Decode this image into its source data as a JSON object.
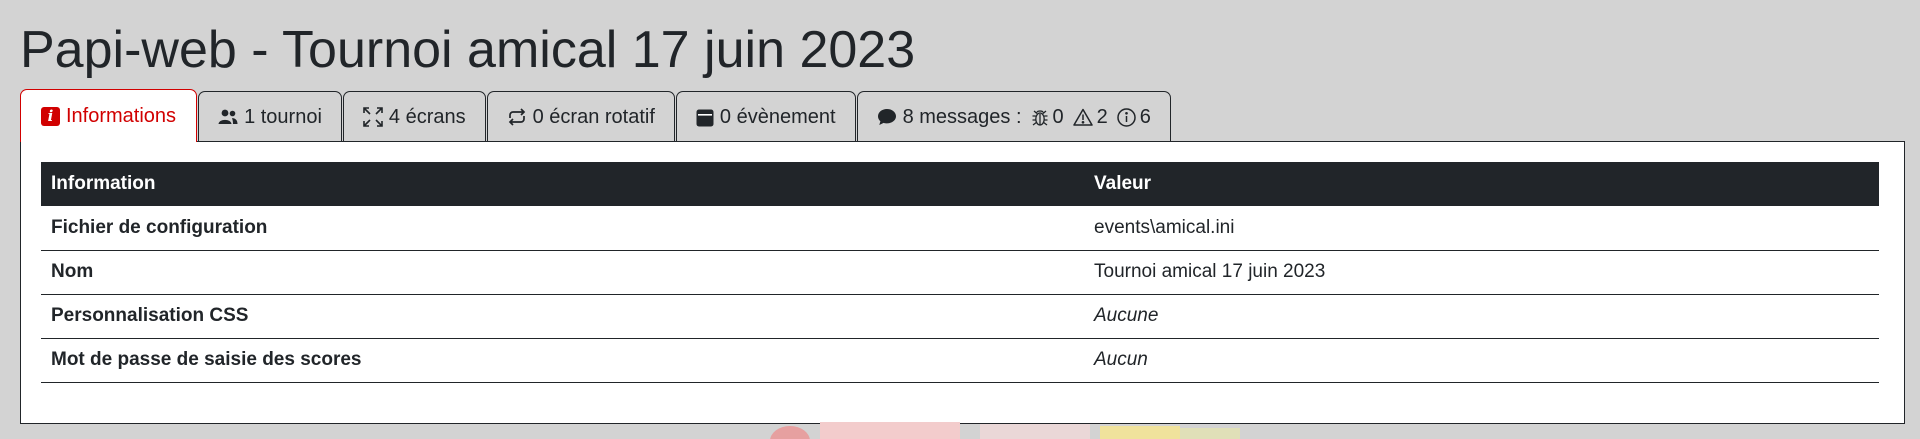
{
  "page": {
    "title": "Papi-web - Tournoi amical 17 juin 2023"
  },
  "tabs": [
    {
      "label": "Informations",
      "icon": "info-icon",
      "active": true
    },
    {
      "label": "1 tournoi",
      "icon": "users-icon",
      "active": false
    },
    {
      "label": "4 écrans",
      "icon": "fullscreen-icon",
      "active": false
    },
    {
      "label": "0 écran rotatif",
      "icon": "repeat-icon",
      "active": false
    },
    {
      "label": "0 évènement",
      "icon": "calendar-icon",
      "active": false
    },
    {
      "label": "8 messages :",
      "icon": "chat-icon",
      "active": false,
      "counts": {
        "bug": "0",
        "warning": "2",
        "info": "6"
      }
    }
  ],
  "table": {
    "headers": [
      "Information",
      "Valeur"
    ],
    "rows": [
      {
        "key": "Fichier de configuration",
        "value": "events\\amical.ini",
        "italic": false
      },
      {
        "key": "Nom",
        "value": "Tournoi amical 17 juin 2023",
        "italic": false
      },
      {
        "key": "Personnalisation CSS",
        "value": "Aucune",
        "italic": true
      },
      {
        "key": "Mot de passe de saisie des scores",
        "value": "Aucun",
        "italic": true
      }
    ]
  },
  "colors": {
    "background": "#d3d3d3",
    "accent": "#d10000",
    "dark": "#212529"
  }
}
